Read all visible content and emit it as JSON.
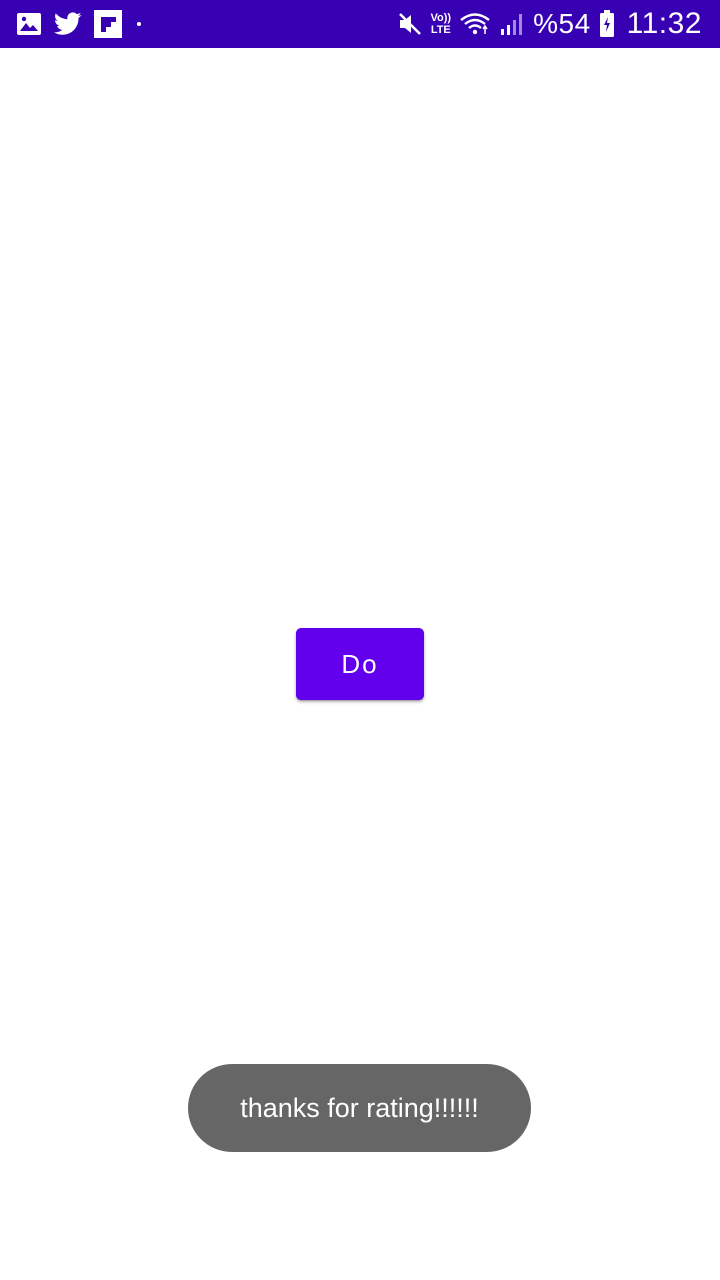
{
  "status_bar": {
    "background_color": "#3700b3",
    "left_icons": [
      "gallery-icon",
      "twitter-icon",
      "flipboard-icon",
      "notification-dot-icon"
    ],
    "right_icons": [
      "mute-icon",
      "volte-icon",
      "wifi-icon",
      "signal-icon",
      "battery-icon"
    ],
    "volte_top": "Vo))",
    "volte_bottom": "LTE",
    "battery_percent": "%54",
    "time": "11:32"
  },
  "main": {
    "button_label": "Do",
    "button_color": "#6200ee"
  },
  "toast": {
    "message": "thanks for rating!!!!!!",
    "background_color": "#666666"
  }
}
